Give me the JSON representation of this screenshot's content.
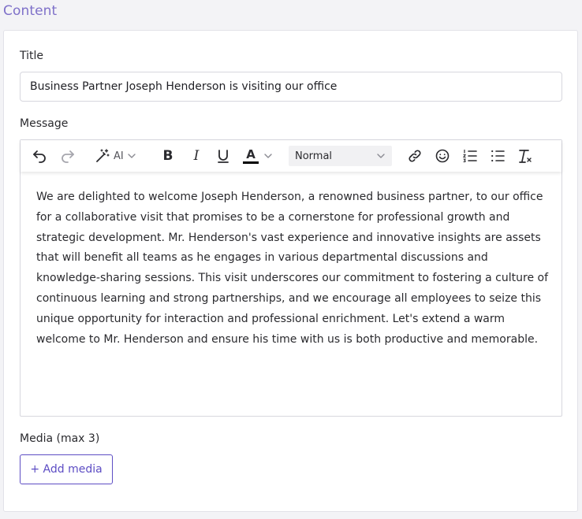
{
  "section": {
    "heading": "Content"
  },
  "title_field": {
    "label": "Title",
    "value": "Business Partner Joseph Henderson is visiting our office"
  },
  "message_field": {
    "label": "Message",
    "toolbar": {
      "ai_label": "AI",
      "bold_glyph": "B",
      "italic_glyph": "I",
      "color_glyph": "A",
      "text_color": "#000000",
      "format_select": {
        "selected": "Normal"
      }
    },
    "body": "We are delighted to welcome Joseph Henderson, a renowned business partner, to our office for a collaborative visit that promises to be a cornerstone for professional growth and strategic development. Mr. Henderson's vast experience and innovative insights are assets that will benefit all teams as he engages in various departmental discussions and knowledge-sharing sessions. This visit underscores our commitment to fostering a culture of continuous learning and strong partnerships, and we encourage all employees to seize this unique opportunity for interaction and professional enrichment. Let's extend a warm welcome to Mr. Henderson and ensure his time with us is both productive and memorable."
  },
  "media_field": {
    "label": "Media (max 3)",
    "add_button": "+ Add media"
  },
  "colors": {
    "accent": "#5d4dc4",
    "heading": "#7e70c9",
    "border": "#d7d7de"
  },
  "icons": [
    "undo-icon",
    "redo-icon",
    "magic-wand-icon",
    "chevron-down-icon",
    "underline-icon",
    "link-icon",
    "emoji-icon",
    "ordered-list-icon",
    "bullet-list-icon",
    "clear-format-icon"
  ]
}
